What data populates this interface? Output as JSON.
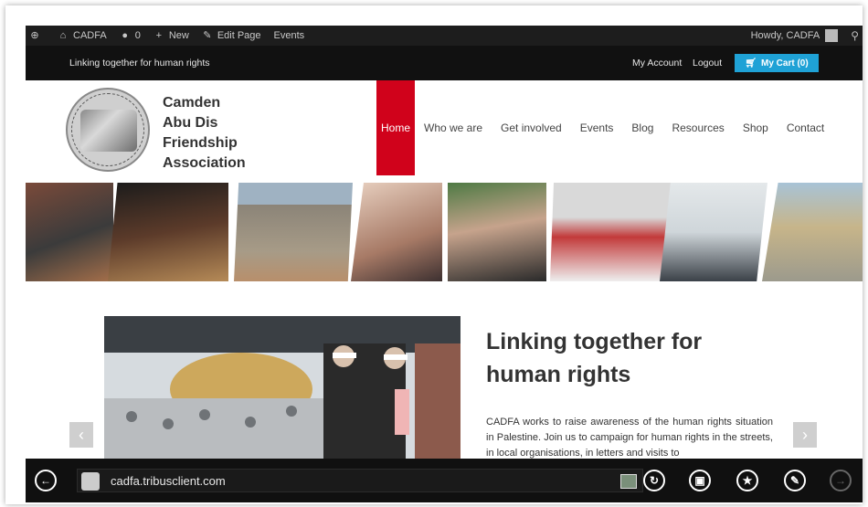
{
  "adminbar": {
    "wp_icon": "wordpress-icon",
    "site": "CADFA",
    "comments_count": "0",
    "new_label": "New",
    "edit_label": "Edit Page",
    "events_label": "Events",
    "howdy": "Howdy, CADFA"
  },
  "topstrip": {
    "tagline": "Linking together for human rights",
    "account": "My Account",
    "logout": "Logout",
    "cart": "My Cart (0)"
  },
  "org": {
    "line1": "Camden",
    "line2": "Abu Dis",
    "line3": "Friendship",
    "line4": "Association"
  },
  "nav": {
    "items": [
      "Home",
      "Who we are",
      "Get involved",
      "Events",
      "Blog",
      "Resources",
      "Shop",
      "Contact"
    ],
    "active_index": 0
  },
  "hero": {
    "title": "Linking together for human rights",
    "text": "CADFA works to raise awareness of the human rights situation in Palestine. Join us to campaign for human rights in the streets, in local organisations, in letters and visits to"
  },
  "browser": {
    "url": "cadfa.tribusclient.com"
  },
  "colors": {
    "accent_red": "#d0021b",
    "cart_blue": "#1fa2d6"
  }
}
